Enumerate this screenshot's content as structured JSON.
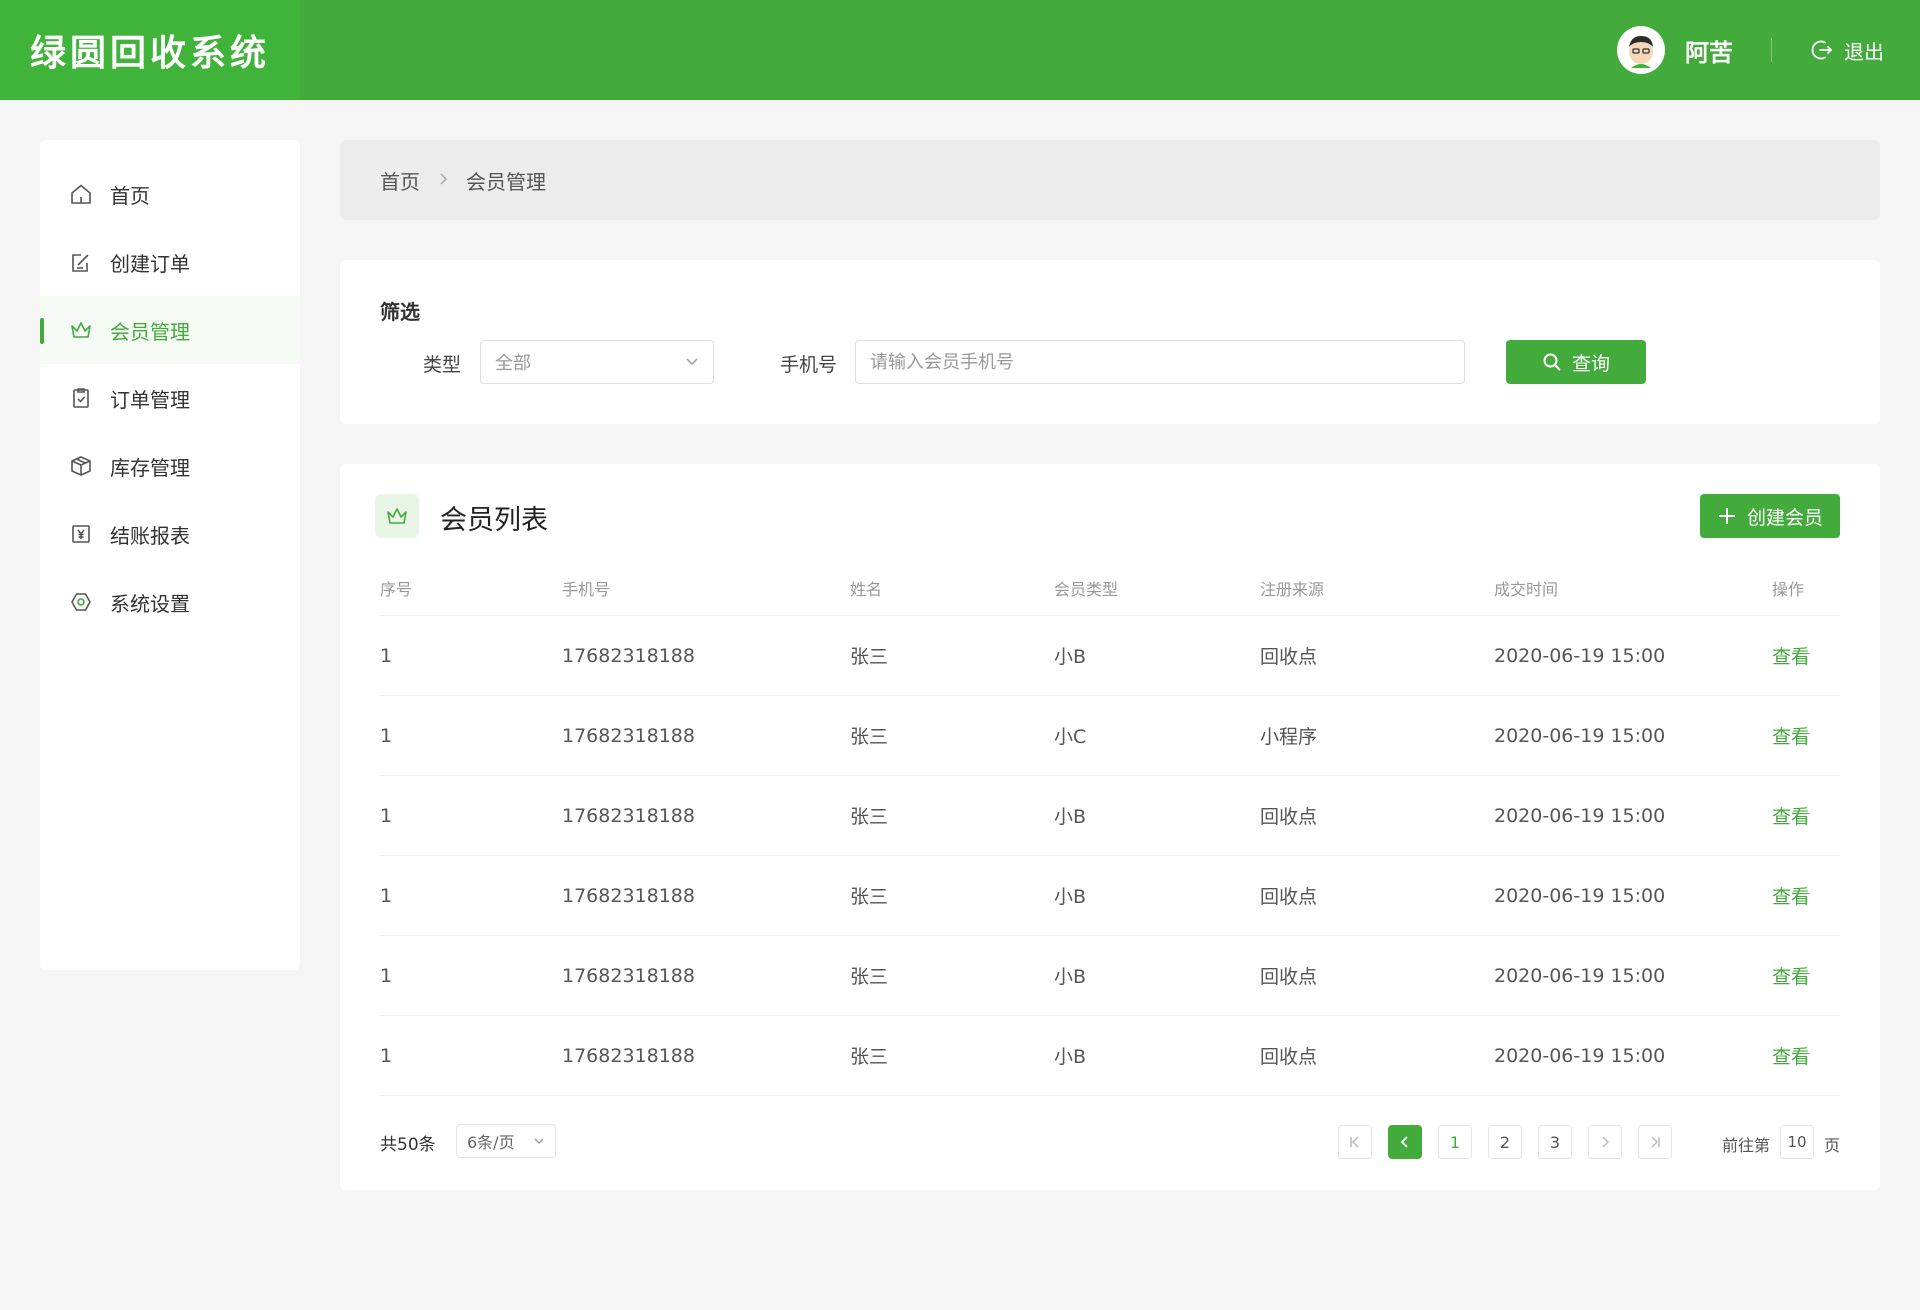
{
  "app": {
    "title": "绿圆回收系统"
  },
  "header": {
    "username": "阿苦",
    "logout_label": "退出"
  },
  "sidebar": {
    "items": [
      {
        "label": "首页",
        "icon": "home-icon"
      },
      {
        "label": "创建订单",
        "icon": "edit-order-icon"
      },
      {
        "label": "会员管理",
        "icon": "crown-icon",
        "active": true
      },
      {
        "label": "订单管理",
        "icon": "clipboard-icon"
      },
      {
        "label": "库存管理",
        "icon": "box-icon"
      },
      {
        "label": "结账报表",
        "icon": "yen-report-icon"
      },
      {
        "label": "系统设置",
        "icon": "settings-icon"
      }
    ]
  },
  "breadcrumb": {
    "home": "首页",
    "current": "会员管理"
  },
  "filter": {
    "title": "筛选",
    "type_label": "类型",
    "type_value": "全部",
    "phone_label": "手机号",
    "phone_placeholder": "请输入会员手机号",
    "query_label": "查询"
  },
  "list": {
    "title": "会员列表",
    "create_label": "创建会员",
    "columns": [
      "序号",
      "手机号",
      "姓名",
      "会员类型",
      "注册来源",
      "成交时间",
      "操作"
    ],
    "rows": [
      {
        "index": "1",
        "phone": "17682318188",
        "name": "张三",
        "type": "小B",
        "source": "回收点",
        "time": "2020-06-19  15:00",
        "action": "查看"
      },
      {
        "index": "1",
        "phone": "17682318188",
        "name": "张三",
        "type": "小C",
        "source": "小程序",
        "time": "2020-06-19  15:00",
        "action": "查看"
      },
      {
        "index": "1",
        "phone": "17682318188",
        "name": "张三",
        "type": "小B",
        "source": "回收点",
        "time": "2020-06-19  15:00",
        "action": "查看"
      },
      {
        "index": "1",
        "phone": "17682318188",
        "name": "张三",
        "type": "小B",
        "source": "回收点",
        "time": "2020-06-19  15:00",
        "action": "查看"
      },
      {
        "index": "1",
        "phone": "17682318188",
        "name": "张三",
        "type": "小B",
        "source": "回收点",
        "time": "2020-06-19  15:00",
        "action": "查看"
      },
      {
        "index": "1",
        "phone": "17682318188",
        "name": "张三",
        "type": "小B",
        "source": "回收点",
        "time": "2020-06-19  15:00",
        "action": "查看"
      }
    ]
  },
  "pagination": {
    "total": "共50条",
    "page_size": "6条/页",
    "pages": [
      "1",
      "2",
      "3"
    ],
    "current_page": "1",
    "goto_prefix": "前往第",
    "goto_value": "10",
    "goto_suffix": "页"
  },
  "colors": {
    "primary": "#43ab3c",
    "logo_bg": "#3fb33a"
  }
}
